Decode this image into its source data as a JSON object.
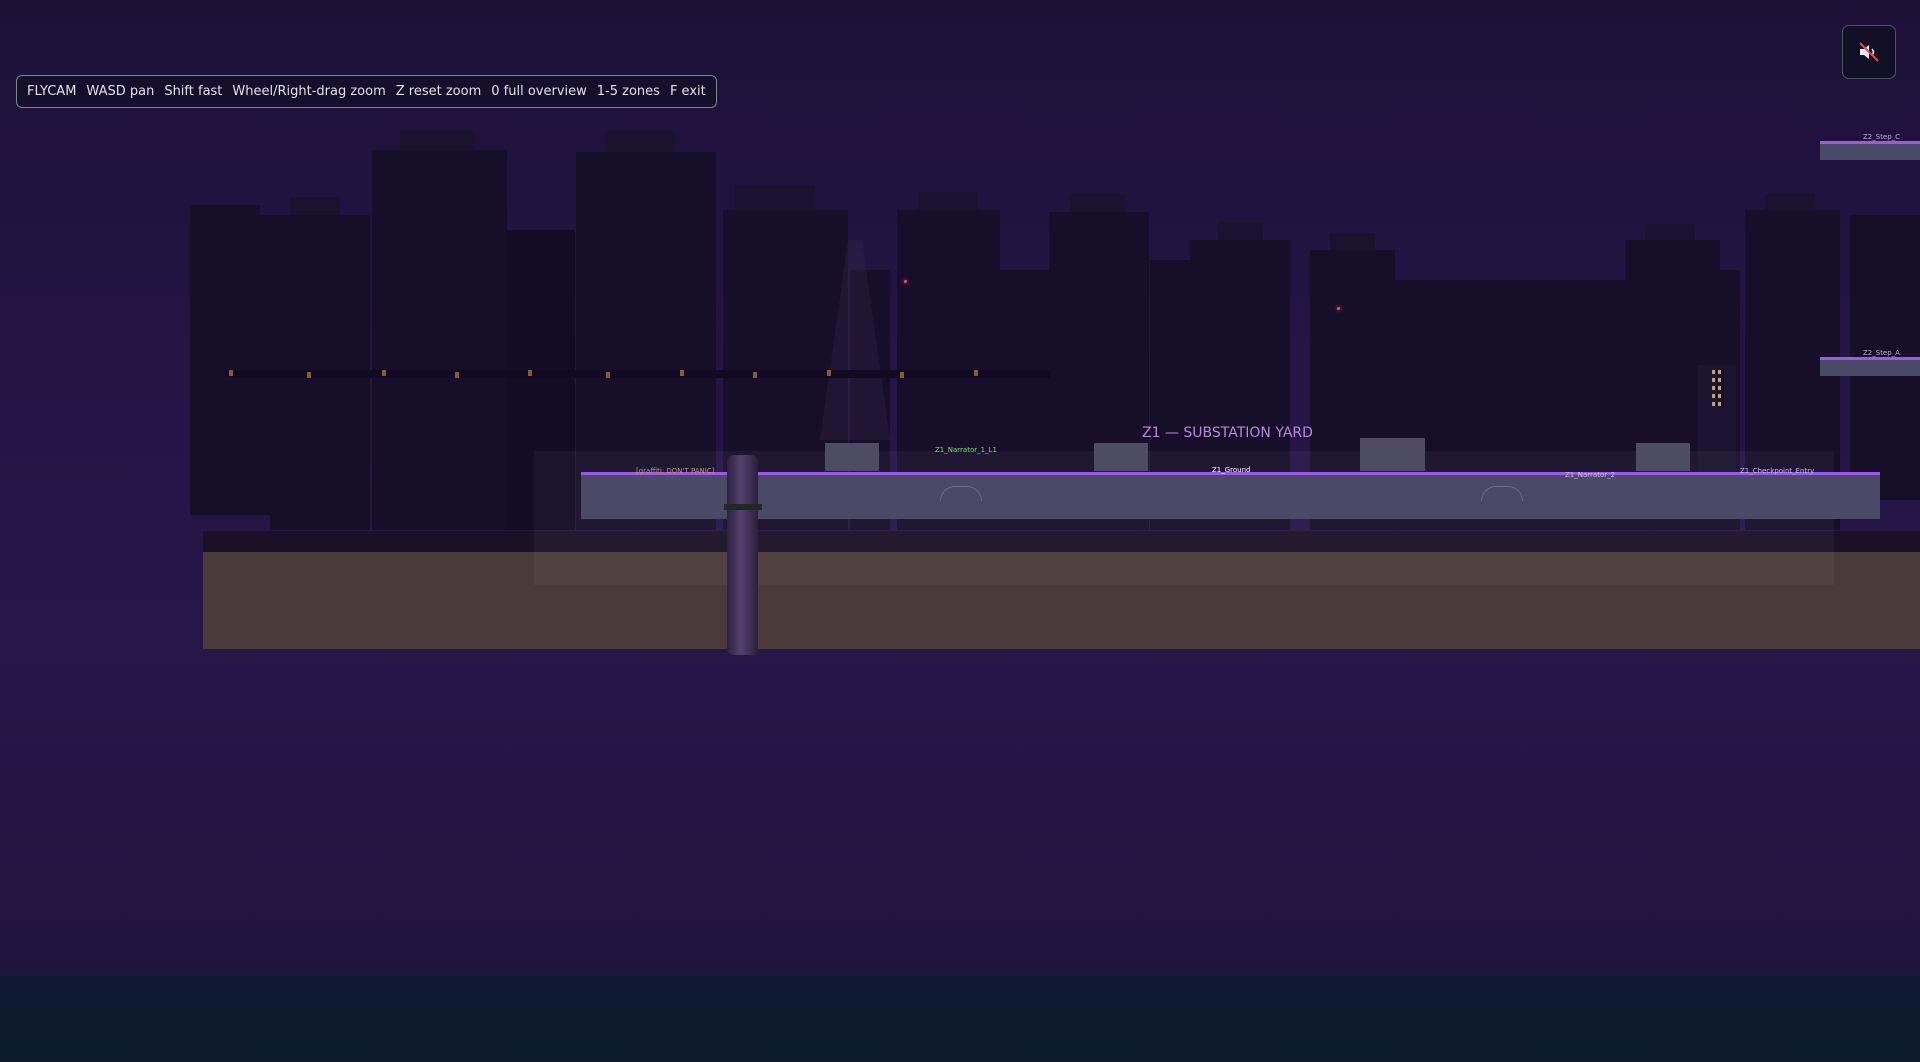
{
  "hud": {
    "items": [
      "FLYCAM",
      "WASD pan",
      "Shift fast",
      "Wheel/Right-drag zoom",
      "Z reset zoom",
      "0 full overview",
      "1-5 zones",
      "F exit"
    ]
  },
  "mute_button": {
    "icon": "speaker-muted-icon"
  },
  "scene": {
    "zone_title": "Z1 — SUBSTATION YARD",
    "labels": {
      "graffiti": "[graffiti: DON'T PANIC]",
      "narrator": "Z1_Narrator_1_L1",
      "ground": "Z1_Ground",
      "checkpoint": "Z1_Checkpoint_Entry",
      "mid_label": "Z1_Narrator_2",
      "step_c": "Z2_Step_C",
      "step_a": "Z2_Step_A"
    }
  },
  "colors": {
    "platform_edge": "#9b59e6",
    "zone_title": "#b88ad8",
    "narrator_label": "#7fdc7f"
  }
}
